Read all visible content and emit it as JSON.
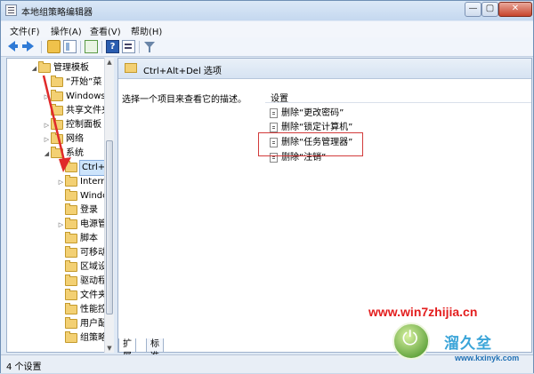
{
  "window": {
    "title": "本地组策略编辑器"
  },
  "menu": [
    "文件(F)",
    "操作(A)",
    "查看(V)",
    "帮助(H)"
  ],
  "tree": {
    "items": [
      {
        "label": "管理模板",
        "exp": "◢",
        "level": 0
      },
      {
        "label": "“开始”菜",
        "exp": "",
        "level": 1
      },
      {
        "label": "Windows",
        "exp": "▷",
        "level": 1
      },
      {
        "label": "共享文件夹",
        "exp": "",
        "level": 1
      },
      {
        "label": "控制面板",
        "exp": "▷",
        "level": 1
      },
      {
        "label": "网络",
        "exp": "▷",
        "level": 1
      },
      {
        "label": "系统",
        "exp": "◢",
        "level": 1
      },
      {
        "label": "Ctrl+A",
        "exp": "",
        "level": 2,
        "selected": true
      },
      {
        "label": "Intern",
        "exp": "▷",
        "level": 2
      },
      {
        "label": "Windo",
        "exp": "",
        "level": 2
      },
      {
        "label": "登录",
        "exp": "",
        "level": 2
      },
      {
        "label": "电源管",
        "exp": "▷",
        "level": 2
      },
      {
        "label": "脚本",
        "exp": "",
        "level": 2
      },
      {
        "label": "可移动",
        "exp": "",
        "level": 2
      },
      {
        "label": "区域设",
        "exp": "",
        "level": 2
      },
      {
        "label": "驱动程",
        "exp": "",
        "level": 2
      },
      {
        "label": "文件夹",
        "exp": "",
        "level": 2
      },
      {
        "label": "性能控",
        "exp": "",
        "level": 2
      },
      {
        "label": "用户配",
        "exp": "",
        "level": 2
      },
      {
        "label": "组策略",
        "exp": "",
        "level": 2
      }
    ]
  },
  "right": {
    "header": "Ctrl+Alt+Del 选项",
    "description": "选择一个项目来查看它的描述。",
    "column": "设置",
    "settings": [
      "删除“更改密码”",
      "删除“锁定计算机”",
      "删除“任务管理器”",
      "删除“注销”"
    ]
  },
  "tabs": [
    "扩展",
    "标准"
  ],
  "status": "4 个设置",
  "watermark": {
    "url_text": "www.win7zhijia.cn",
    "logo_text": "溜久坌",
    "site": "www.kxinyk.com"
  },
  "colors": {
    "highlight": "#d23b3b",
    "accent": "#2f7ad6"
  }
}
